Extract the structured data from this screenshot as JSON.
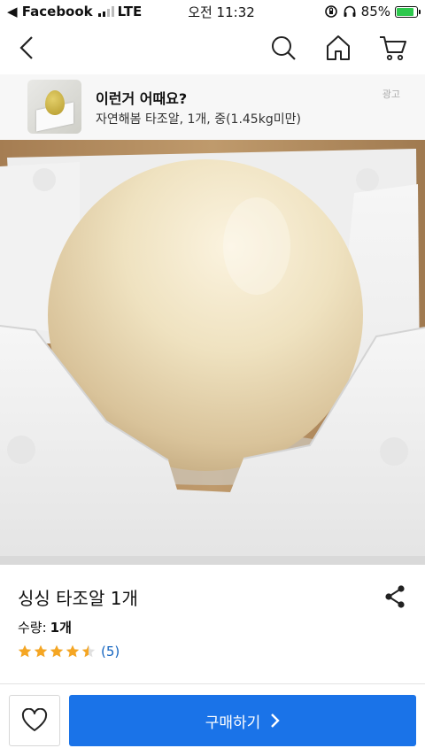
{
  "status_bar": {
    "back_app": "◀ Facebook",
    "network": "LTE",
    "time": "오전 11:32",
    "battery": "85%",
    "battery_level": 0.85
  },
  "nav": {
    "back_icon": "chevron-left-icon",
    "search_icon": "search-icon",
    "home_icon": "home-icon",
    "cart_icon": "cart-icon"
  },
  "ad": {
    "title": "이런거 어때요?",
    "subtitle": "자연해봄 타조알, 1개, 중(1.45kg미만)",
    "tag": "광고"
  },
  "product": {
    "title": "싱싱 타조알 1개",
    "quantity_label": "수량:",
    "quantity_value": "1개",
    "rating": 4.5,
    "review_count": "(5)"
  },
  "bottom_bar": {
    "wishlist_icon": "heart-icon",
    "buy_label": "구매하기"
  },
  "colors": {
    "accent": "#1a73e8",
    "star": "#f5a623",
    "review_link": "#1565c0"
  }
}
